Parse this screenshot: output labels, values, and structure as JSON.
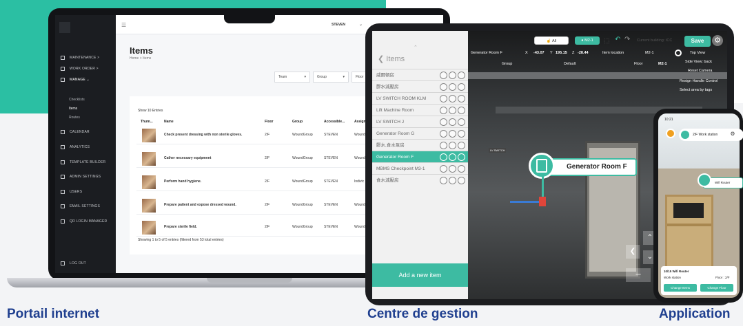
{
  "captions": {
    "portal": "Portail internet",
    "management": "Centre de gestion",
    "application": "Application"
  },
  "portal": {
    "sidebar": [
      {
        "label": "MAINTENANCE",
        "chevron": ">"
      },
      {
        "label": "WORK ORDER",
        "chevron": ">"
      },
      {
        "label": "MANAGE",
        "chevron": "⌄"
      },
      {
        "label": "CALENDAR"
      },
      {
        "label": "ANALYTICS"
      },
      {
        "label": "TEMPLATE BUILDER"
      },
      {
        "label": "ADMIN SETTINGS"
      },
      {
        "label": "USERS"
      },
      {
        "label": "EMAIL SETTINGS"
      },
      {
        "label": "QR LOGIN MANAGER"
      },
      {
        "label": "LOG OUT"
      }
    ],
    "submenu": [
      "Checklists",
      "Items",
      "Routes"
    ],
    "user": "STEVEN",
    "user_chevron": "⌄",
    "title": "Items",
    "breadcrumb": "Home > Items",
    "filters": [
      "Team",
      "Group",
      "Floor"
    ],
    "show_entries": "Show  10  Entries",
    "columns": [
      "Thum...",
      "Name",
      "Floor",
      "Group",
      "Accessible...",
      "Assign"
    ],
    "rows": [
      {
        "name": "Check present dressing with non sterile gloves.",
        "floor": "2/F",
        "group": "WoundGroup",
        "access": "STEVEN",
        "assign": "Wound"
      },
      {
        "name": "Cather necessary equipment",
        "floor": "2/F",
        "group": "WoundGroup",
        "access": "STEVEN",
        "assign": "Wound"
      },
      {
        "name": "Perform hand hygiene.",
        "floor": "2/F",
        "group": "WoundGroup",
        "access": "STEVEN",
        "assign": "Indivic"
      },
      {
        "name": "Prepare patient and expose dressed wound.",
        "floor": "2/F",
        "group": "WoundGroup",
        "access": "STEVEN",
        "assign": "Wound"
      },
      {
        "name": "Prepare sterile field.",
        "floor": "2/F",
        "group": "WoundGroup",
        "access": "STEVEN",
        "assign": "Wound"
      }
    ],
    "footer": "Showing 1 to 5 of 5 entries (filtered from 53 total entries)"
  },
  "tablet": {
    "back_label": "Items",
    "items": [
      "威爾頓房",
      "膠水減壓房",
      "LV SWITCH ROOM KLM",
      "Lift Machine Room",
      "LV SWITCH J",
      "Generator Room G",
      "膠水,食水泵房",
      "Generator Room F",
      "MBMS Checkpoint M3-1",
      "食水減壓房"
    ],
    "selected_index": 7,
    "add_button": "Add a new item",
    "toolbar": {
      "all": "All",
      "level": "M2-1",
      "building": "Current building: ICC",
      "save": "Save"
    },
    "hud": {
      "room": "Generator Room F",
      "x_label": "X",
      "x": "-43.07",
      "y_label": "Y",
      "y": "195.15",
      "z_label": "Z",
      "z": "-28.44",
      "item_location": "Item location",
      "level_tag": "M2-1",
      "top_view": "Top View",
      "group_label": "Group",
      "group": "Default",
      "floor_label": "Floor",
      "floor": "M2-1",
      "side_view": "Side View: back",
      "reset_camera": "Reset Camera",
      "resign": "Resign Handle Control",
      "select_tags": "Select area by tags"
    },
    "marker_label": "Generator Room F",
    "sign_text": "LV SWITCH"
  },
  "phone": {
    "time": "10:21",
    "floor": "2/F",
    "location": "Work station",
    "wifi_tag": "Wifi Router",
    "panel_title": "10/15 Wifi Router",
    "panel_location": "Work station",
    "panel_floor": "Floor : 2/F",
    "btn_change_item": "Change Items",
    "btn_change_floor": "Change Floor"
  },
  "colors": {
    "teal": "#2bbfa3",
    "accent": "#3dbba2",
    "caption": "#1f3f8f"
  }
}
